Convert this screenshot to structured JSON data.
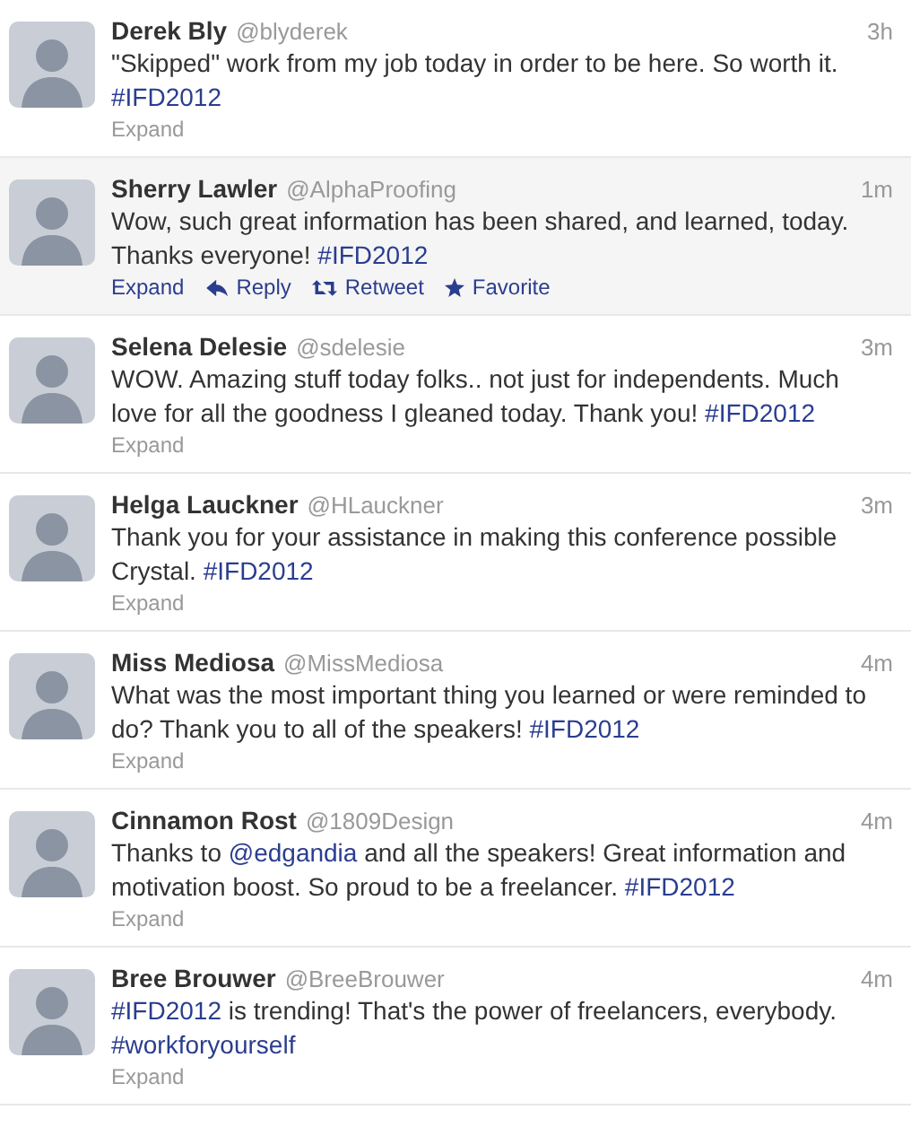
{
  "tweets": [
    {
      "name": "Derek Bly",
      "handle": "@blyderek",
      "time": "3h",
      "hovered": false,
      "text": [
        {
          "kind": "text",
          "text": "\"Skipped\" work from my job today in order to be here. So worth it. "
        },
        {
          "kind": "hashtag",
          "text": "#IFD2012"
        }
      ],
      "actions": [
        {
          "kind": "expand",
          "label": "Expand"
        }
      ]
    },
    {
      "name": "Sherry Lawler",
      "handle": "@AlphaProofing",
      "time": "1m",
      "hovered": true,
      "text": [
        {
          "kind": "text",
          "text": "Wow, such great information has been shared, and learned, today. Thanks everyone! "
        },
        {
          "kind": "hashtag",
          "text": "#IFD2012"
        }
      ],
      "actions": [
        {
          "kind": "expand",
          "label": "Expand"
        },
        {
          "kind": "reply",
          "label": "Reply"
        },
        {
          "kind": "retweet",
          "label": "Retweet"
        },
        {
          "kind": "favorite",
          "label": "Favorite"
        }
      ]
    },
    {
      "name": "Selena Delesie",
      "handle": "@sdelesie",
      "time": "3m",
      "hovered": false,
      "text": [
        {
          "kind": "text",
          "text": "WOW. Amazing stuff today folks.. not just for independents. Much love for all the goodness I gleaned today. Thank you! "
        },
        {
          "kind": "hashtag",
          "text": "#IFD2012"
        }
      ],
      "actions": [
        {
          "kind": "expand",
          "label": "Expand"
        }
      ]
    },
    {
      "name": "Helga Lauckner",
      "handle": "@HLauckner",
      "time": "3m",
      "hovered": false,
      "text": [
        {
          "kind": "text",
          "text": "Thank you for your assistance in making this conference possible Crystal. "
        },
        {
          "kind": "hashtag",
          "text": "#IFD2012"
        }
      ],
      "actions": [
        {
          "kind": "expand",
          "label": "Expand"
        }
      ]
    },
    {
      "name": "Miss Mediosa",
      "handle": "@MissMediosa",
      "time": "4m",
      "hovered": false,
      "text": [
        {
          "kind": "text",
          "text": "What was the most important thing you learned or were reminded to do? Thank you to all of the speakers! "
        },
        {
          "kind": "hashtag",
          "text": "#IFD2012"
        }
      ],
      "actions": [
        {
          "kind": "expand",
          "label": "Expand"
        }
      ]
    },
    {
      "name": "Cinnamon Rost",
      "handle": "@1809Design",
      "time": "4m",
      "hovered": false,
      "text": [
        {
          "kind": "text",
          "text": "Thanks to "
        },
        {
          "kind": "mention",
          "text": "@edgandia"
        },
        {
          "kind": "text",
          "text": " and all the speakers! Great information and motivation boost. So proud to be a freelancer. "
        },
        {
          "kind": "hashtag",
          "text": "#IFD2012"
        }
      ],
      "actions": [
        {
          "kind": "expand",
          "label": "Expand"
        }
      ]
    },
    {
      "name": "Bree Brouwer",
      "handle": "@BreeBrouwer",
      "time": "4m",
      "hovered": false,
      "text": [
        {
          "kind": "hashtag",
          "text": "#IFD2012"
        },
        {
          "kind": "text",
          "text": " is trending! That's the power of freelancers, everybody. "
        },
        {
          "kind": "hashtag",
          "text": "#workforyourself"
        }
      ],
      "actions": [
        {
          "kind": "expand",
          "label": "Expand"
        }
      ]
    }
  ]
}
